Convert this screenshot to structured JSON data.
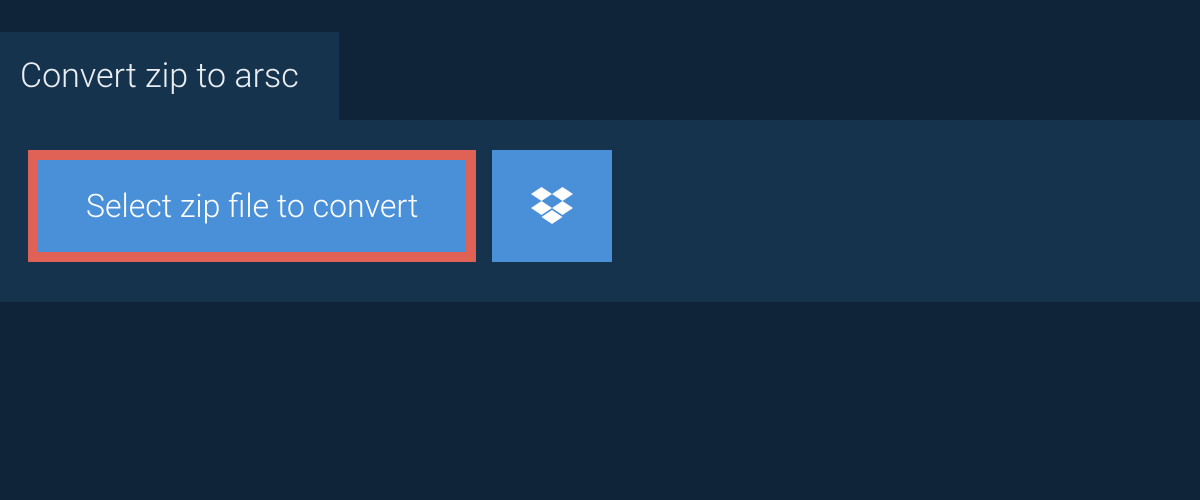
{
  "header": {
    "title": "Convert zip to arsc"
  },
  "actions": {
    "select_file_label": "Select zip file to convert"
  },
  "colors": {
    "page_bg": "#0f2438",
    "panel_bg": "#16334d",
    "button_bg": "#4a90d9",
    "button_border": "#e06257",
    "text_light": "#ffffff",
    "text_header": "#e8eef3"
  }
}
